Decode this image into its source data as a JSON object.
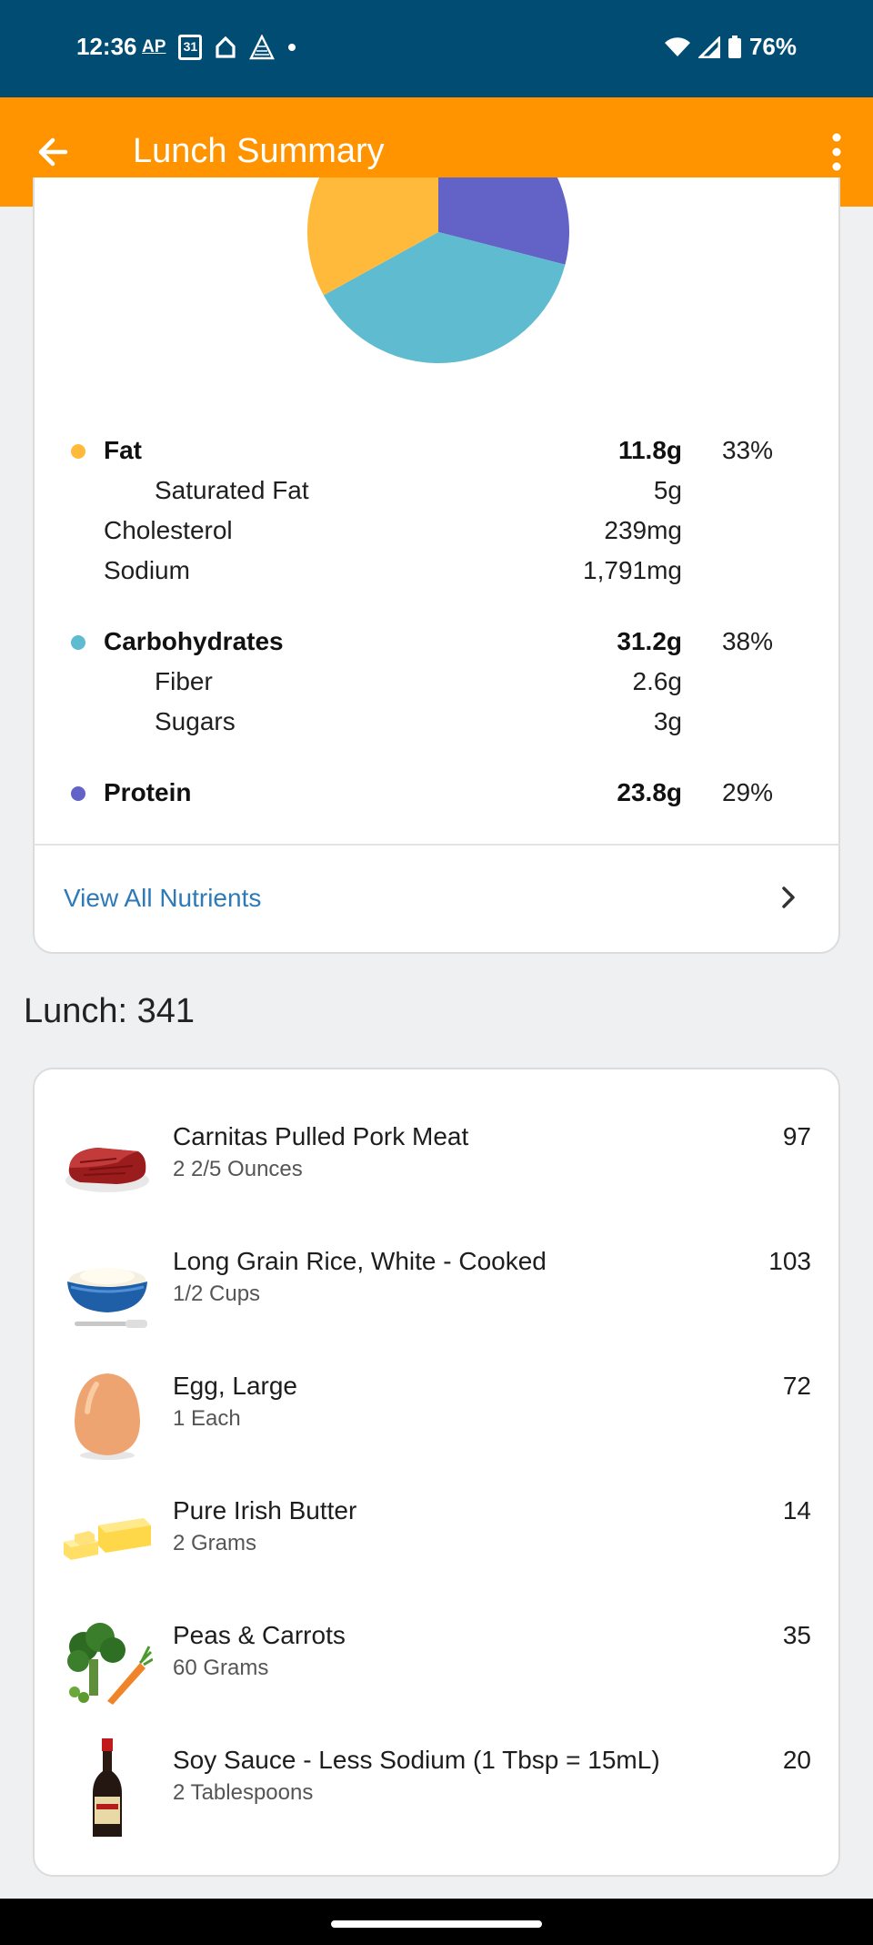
{
  "status_bar": {
    "time": "12:36",
    "ap": "AP",
    "calendar_day": "31",
    "battery": "76%"
  },
  "app_bar": {
    "title": "Lunch Summary"
  },
  "chart_data": {
    "type": "pie",
    "slices": [
      {
        "name": "Fat",
        "value": 33,
        "color": "#ffba3b"
      },
      {
        "name": "Carbohydrates",
        "value": 38,
        "color": "#5fbcd0"
      },
      {
        "name": "Protein",
        "value": 29,
        "color": "#6362c6"
      }
    ]
  },
  "nutrients": {
    "fat": {
      "label": "Fat",
      "value": "11.8g",
      "pct": "33%",
      "color": "#ffba3b"
    },
    "saturated_fat": {
      "label": "Saturated Fat",
      "value": "5g"
    },
    "cholesterol": {
      "label": "Cholesterol",
      "value": "239mg"
    },
    "sodium": {
      "label": "Sodium",
      "value": "1,791mg"
    },
    "carbs": {
      "label": "Carbohydrates",
      "value": "31.2g",
      "pct": "38%",
      "color": "#5fbcd0"
    },
    "fiber": {
      "label": "Fiber",
      "value": "2.6g"
    },
    "sugars": {
      "label": "Sugars",
      "value": "3g"
    },
    "protein": {
      "label": "Protein",
      "value": "23.8g",
      "pct": "29%",
      "color": "#6362c6"
    }
  },
  "view_all_label": "View All Nutrients",
  "lunch_total": "Lunch: 341",
  "foods": [
    {
      "name": "Carnitas Pulled Pork Meat",
      "serving": "2 2/5 Ounces",
      "calories": "97",
      "icon": "meat-icon"
    },
    {
      "name": "Long Grain Rice, White - Cooked",
      "serving": "1/2 Cups",
      "calories": "103",
      "icon": "rice-bowl-icon"
    },
    {
      "name": "Egg, Large",
      "serving": "1 Each",
      "calories": "72",
      "icon": "egg-icon"
    },
    {
      "name": "Pure Irish Butter",
      "serving": "2 Grams",
      "calories": "14",
      "icon": "butter-icon"
    },
    {
      "name": "Peas & Carrots",
      "serving": "60 Grams",
      "calories": "35",
      "icon": "vegetables-icon"
    },
    {
      "name": "Soy Sauce - Less Sodium (1 Tbsp = 15mL)",
      "serving": "2 Tablespoons",
      "calories": "20",
      "icon": "sauce-bottle-icon"
    }
  ]
}
